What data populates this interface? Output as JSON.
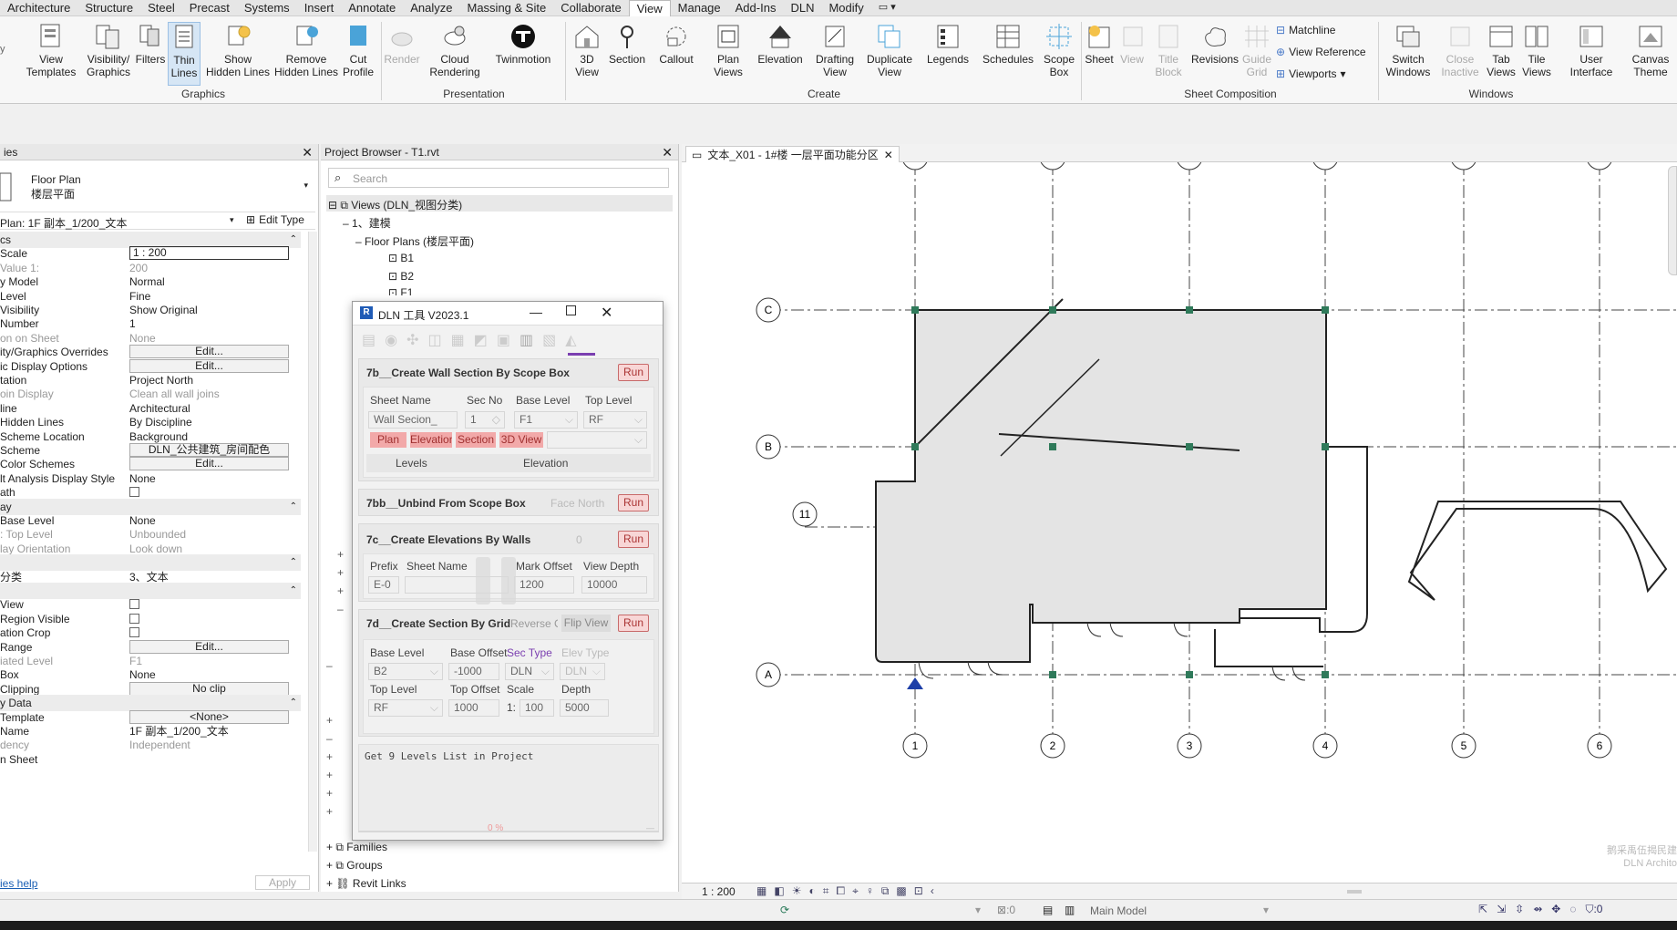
{
  "ribbon": {
    "tabs": [
      "Architecture",
      "Structure",
      "Steel",
      "Precast",
      "Systems",
      "Insert",
      "Annotate",
      "Analyze",
      "Massing & Site",
      "Collaborate",
      "View",
      "Manage",
      "Add-Ins",
      "DLN",
      "Modify"
    ],
    "active_tab": "View",
    "buttons": {
      "view_templates": "View\nTemplates",
      "visibility_graphics": "Visibility/\nGraphics",
      "filters": "Filters",
      "thin_lines": "Thin\nLines",
      "show_hidden_lines": "Show\nHidden Lines",
      "remove_hidden_lines": "Remove\nHidden Lines",
      "cut_profile": "Cut\nProfile",
      "render": "Render",
      "cloud_rendering": "Cloud\nRendering",
      "twinmotion": "Twinmotion",
      "view_3d": "3D\nView",
      "section": "Section",
      "callout": "Callout",
      "plan_views": "Plan\nViews",
      "elevation": "Elevation",
      "drafting_view": "Drafting\nView",
      "duplicate_view": "Duplicate\nView",
      "legends": "Legends",
      "schedules": "Schedules",
      "scope_box": "Scope\nBox",
      "sheet": "Sheet",
      "view": "View",
      "title_block": "Title\nBlock",
      "revisions": "Revisions",
      "guide_grid": "Guide\nGrid",
      "matchline": "Matchline",
      "view_reference": "View  Reference",
      "viewports": "Viewports",
      "switch_windows": "Switch\nWindows",
      "close_inactive": "Close\nInactive",
      "tab_views": "Tab\nViews",
      "tile_views": "Tile\nViews",
      "user_interface": "User\nInterface",
      "canvas_theme": "Canvas\nTheme"
    },
    "groups": {
      "graphics": "Graphics",
      "presentation": "Presentation",
      "create": "Create",
      "sheet_composition": "Sheet Composition",
      "windows": "Windows"
    }
  },
  "properties": {
    "header": "ies",
    "type_name": "Floor Plan",
    "type_sub": "楼层平面",
    "instance_selector": "Plan: 1F 副本_1/200_文本",
    "edit_type": "Edit Type",
    "rows": [
      {
        "k": "cs",
        "v": "",
        "sec": true
      },
      {
        "k": "Scale",
        "v": "1 : 200",
        "input": true
      },
      {
        "k": "Value    1:",
        "v": "200",
        "g": true
      },
      {
        "k": "y Model",
        "v": "Normal"
      },
      {
        "k": "Level",
        "v": "Fine"
      },
      {
        "k": "Visibility",
        "v": "Show Original"
      },
      {
        "k": "Number",
        "v": "1"
      },
      {
        "k": "on on Sheet",
        "v": "None",
        "g": true
      },
      {
        "k": "ity/Graphics Overrides",
        "v": "Edit...",
        "btn": true
      },
      {
        "k": "ic Display Options",
        "v": "Edit...",
        "btn": true
      },
      {
        "k": "tation",
        "v": "Project North"
      },
      {
        "k": "oin Display",
        "v": "Clean all wall joins",
        "g": true
      },
      {
        "k": "line",
        "v": "Architectural"
      },
      {
        "k": "Hidden Lines",
        "v": "By Discipline"
      },
      {
        "k": "Scheme Location",
        "v": "Background"
      },
      {
        "k": "Scheme",
        "v": "DLN_公共建筑_房间配色",
        "btn": true
      },
      {
        "k": "Color Schemes",
        "v": "Edit...",
        "btn": true
      },
      {
        "k": "lt Analysis Display Style",
        "v": "None"
      },
      {
        "k": "ath",
        "v": "",
        "chk": true
      },
      {
        "k": "ay",
        "v": "",
        "sec": true
      },
      {
        "k": "Base Level",
        "v": "None"
      },
      {
        "k": ": Top Level",
        "v": "Unbounded",
        "g": true
      },
      {
        "k": "lay Orientation",
        "v": "Look down",
        "g": true
      },
      {
        "k": "",
        "v": "",
        "sec": true
      },
      {
        "k": "分类",
        "v": "3、文本"
      },
      {
        "k": "",
        "v": "",
        "sec": true
      },
      {
        "k": "View",
        "v": "",
        "chk": true
      },
      {
        "k": "Region Visible",
        "v": "",
        "chk": true
      },
      {
        "k": "ation Crop",
        "v": "",
        "chk": true
      },
      {
        "k": "Range",
        "v": "Edit...",
        "btn": true
      },
      {
        "k": "iated Level",
        "v": "F1",
        "g": true
      },
      {
        "k": "Box",
        "v": "None"
      },
      {
        "k": "Clipping",
        "v": "No clip",
        "btn": true
      },
      {
        "k": "y Data",
        "v": "",
        "sec": true
      },
      {
        "k": "Template",
        "v": "<None>",
        "btn": true
      },
      {
        "k": "Name",
        "v": "1F 副本_1/200_文本"
      },
      {
        "k": "dency",
        "v": "Independent",
        "g": true
      },
      {
        "k": "n Sheet",
        "v": ""
      }
    ],
    "help": "ies help",
    "apply": "Apply"
  },
  "browser": {
    "title": "Project Browser - T1.rvt",
    "search_placeholder": "Search",
    "tree": {
      "views": "Views (DLN_视图分类)",
      "jianmo": "1、建模",
      "floor_plans": "Floor Plans (楼层平面)",
      "b1": "B1",
      "b2": "B2",
      "f1": "F1",
      "families": "Families",
      "groups": "Groups",
      "revit_links": "Revit Links"
    }
  },
  "dialog": {
    "title": "DLN 工具 V2023.1",
    "run": "Run",
    "s7b": {
      "title": "7b__Create Wall Section By Scope Box",
      "sheet_name_label": "Sheet Name",
      "sec_no_label": "Sec No",
      "base_level_label": "Base Level",
      "top_level_label": "Top Level",
      "sheet_name": "Wall Secion_",
      "sec_no": "1",
      "base_level": "F1",
      "top_level": "RF",
      "plan": "Plan",
      "elevation": "Elevation",
      "section": "Section",
      "view3d": "3D View",
      "levels": "Levels",
      "elevation_lbl": "Elevation"
    },
    "s7bb": {
      "title": "7bb__Unbind From Scope Box",
      "face_north": "Face North"
    },
    "s7c": {
      "title": "7c__Create Elevations By Walls",
      "zero": "0",
      "prefix_label": "Prefix",
      "sheet_name_label": "Sheet Name",
      "mark_offset_label": "Mark Offset",
      "view_depth_label": "View Depth",
      "prefix": "E-0",
      "mark_offset": "1200",
      "view_depth": "10000"
    },
    "s7d": {
      "title": "7d__Create Section By Grid",
      "reverse": "Reverse C",
      "flip_view": "Flip View",
      "base_level_label": "Base Level",
      "base_offset_label": "Base Offset",
      "sec_type_label": "Sec Type",
      "elev_type_label": "Elev Type",
      "base_level": "B2",
      "base_offset": "-1000",
      "sec_type": "DLN",
      "elev_type": "DLN",
      "top_level_label": "Top Level",
      "top_offset_label": "Top Offset",
      "scale_label": "Scale",
      "depth_label": "Depth",
      "top_level": "RF",
      "top_offset": "1000",
      "scale_prefix": "1:",
      "scale": "100",
      "depth": "5000"
    },
    "log": "Get 9 Levels List in Project",
    "progress": "0 %",
    "progress_value": 0
  },
  "view": {
    "tab_title": "文本_X01 - 1#楼 一层平面功能分区",
    "grids_h": [
      "C",
      "B",
      "11",
      "A"
    ],
    "grids_v": [
      "1",
      "2",
      "3",
      "4",
      "5",
      "6"
    ],
    "watermark1": "鹅采禹伍揭民建",
    "watermark2": "DLN Archito",
    "scale": "1 : 200"
  },
  "status": {
    "zero": ":0",
    "model": "Main Model",
    "filter_count": ":0"
  },
  "colors": {
    "accent": "#7b3fb0",
    "run_bg": "#f8d6d6",
    "run_border": "#c86a6a",
    "pink": "#f2a9a9"
  }
}
